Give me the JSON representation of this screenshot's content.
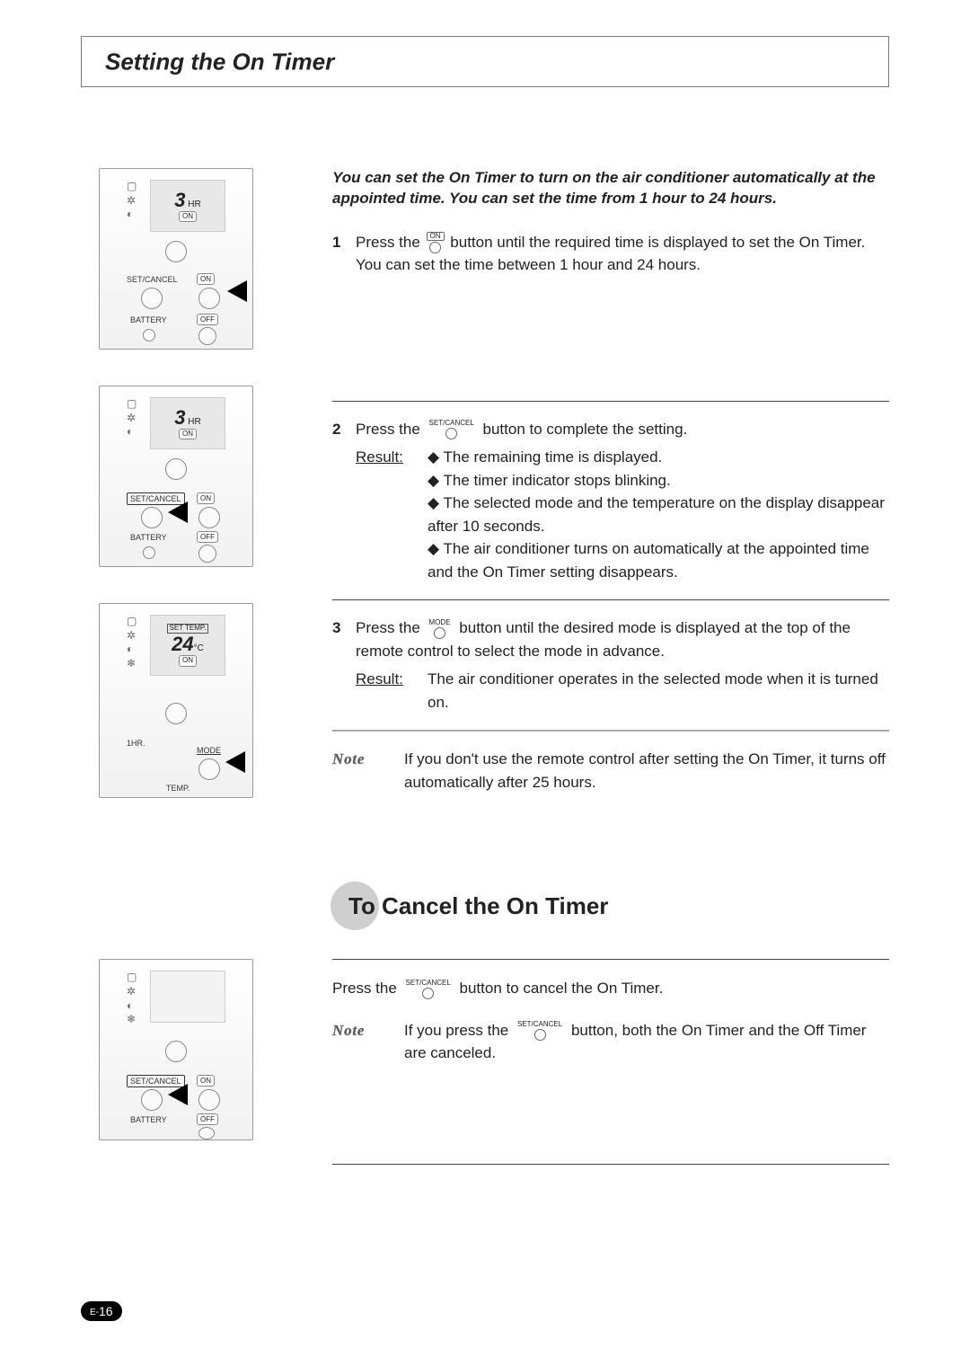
{
  "page": {
    "title": "Setting the On Timer",
    "intro": "You can set the On Timer to turn on the air conditioner automatically at the appointed time. You can set the time from 1 hour to 24 hours.",
    "steps": {
      "s1": {
        "num": "1",
        "pre": "Press the",
        "btn_label": "ON",
        "post": "button until the required time is displayed to set the On Timer.",
        "line2": "You can set the time between 1 hour and 24 hours."
      },
      "s2": {
        "num": "2",
        "pre": "Press the",
        "btn_label": "SET/CANCEL",
        "post": "button to complete the setting.",
        "result_label": "Result:",
        "bullets": [
          "The remaining time is displayed.",
          "The timer indicator stops blinking.",
          "The selected mode and the temperature on the display disappear after 10 seconds.",
          "The air conditioner turns on automatically at the appointed time and the On Timer setting disappears."
        ]
      },
      "s3": {
        "num": "3",
        "pre": "Press the",
        "btn_label": "MODE",
        "post": "button until the desired mode is displayed at the top of the remote control to select the mode in advance.",
        "result_label": "Result:",
        "result_text": "The air conditioner operates in the selected mode when it is turned on."
      },
      "note1": {
        "label": "Note",
        "text": "If you don't use the remote control after setting the On Timer, it turns off automatically after 25 hours."
      }
    },
    "cancel": {
      "heading": "To Cancel the On Timer",
      "line_pre": "Press the",
      "line_btn": "SET/CANCEL",
      "line_post": "button to cancel the On Timer.",
      "note": {
        "label": "Note",
        "pre": "If you press the",
        "btn": "SET/CANCEL",
        "post": "button, both the On Timer and the Off Timer are canceled."
      }
    },
    "footer": {
      "page_prefix": "E-",
      "page_number": "16"
    }
  },
  "remote": {
    "hr_label": "HR",
    "on_label": "ON",
    "off_label": "OFF",
    "setcancel": "SET/CANCEL",
    "battery": "BATTERY",
    "mode": "MODE",
    "temp": "TEMP.",
    "one_hr": "1HR.",
    "set_temp": "SET TEMP.",
    "value_3": "3",
    "value_24": "24",
    "deg_c": "°C"
  }
}
